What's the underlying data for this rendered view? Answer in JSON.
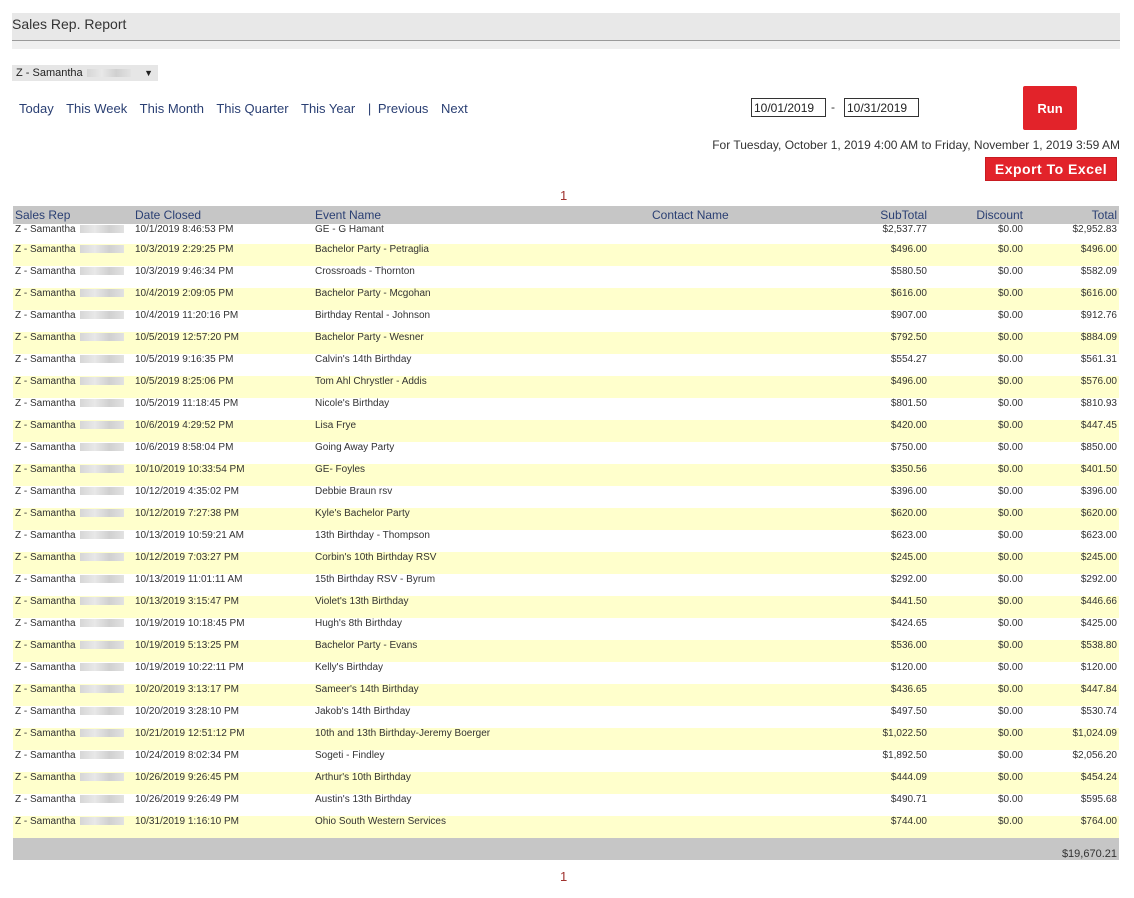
{
  "header": {
    "title": "Sales Rep. Report"
  },
  "rep_select": {
    "value": "Z - Samantha"
  },
  "periods": [
    "Today",
    "This Week",
    "This Month",
    "This Quarter",
    "This Year"
  ],
  "period_separator": "|",
  "nav": {
    "previous": "Previous",
    "next": "Next"
  },
  "date_range": {
    "start": "10/01/2019",
    "dash": "-",
    "end": "10/31/2019"
  },
  "run_label": "Run",
  "range_text": "For Tuesday, October 1, 2019 4:00 AM to Friday, November 1, 2019 3:59 AM",
  "export_label": "Export To Excel",
  "pagination": {
    "current": "1"
  },
  "table": {
    "columns": [
      "Sales Rep",
      "Date Closed",
      "Event Name",
      "Contact Name",
      "SubTotal",
      "Discount",
      "Total"
    ],
    "rows": [
      {
        "rep": "Z - Samantha",
        "date": "10/1/2019 8:46:53 PM",
        "event": "GE - G Hamant",
        "contact": "",
        "subtotal": "$2,537.77",
        "discount": "$0.00",
        "total": "$2,952.83"
      },
      {
        "rep": "Z - Samantha",
        "date": "10/3/2019 2:29:25 PM",
        "event": "Bachelor Party - Petraglia",
        "contact": "",
        "subtotal": "$496.00",
        "discount": "$0.00",
        "total": "$496.00"
      },
      {
        "rep": "Z - Samantha",
        "date": "10/3/2019 9:46:34 PM",
        "event": "Crossroads - Thornton",
        "contact": "",
        "subtotal": "$580.50",
        "discount": "$0.00",
        "total": "$582.09"
      },
      {
        "rep": "Z - Samantha",
        "date": "10/4/2019 2:09:05 PM",
        "event": "Bachelor Party - Mcgohan",
        "contact": "",
        "subtotal": "$616.00",
        "discount": "$0.00",
        "total": "$616.00"
      },
      {
        "rep": "Z - Samantha",
        "date": "10/4/2019 11:20:16 PM",
        "event": "Birthday Rental - Johnson",
        "contact": "",
        "subtotal": "$907.00",
        "discount": "$0.00",
        "total": "$912.76"
      },
      {
        "rep": "Z - Samantha",
        "date": "10/5/2019 12:57:20 PM",
        "event": "Bachelor Party - Wesner",
        "contact": "",
        "subtotal": "$792.50",
        "discount": "$0.00",
        "total": "$884.09"
      },
      {
        "rep": "Z - Samantha",
        "date": "10/5/2019 9:16:35 PM",
        "event": "Calvin's 14th Birthday",
        "contact": "",
        "subtotal": "$554.27",
        "discount": "$0.00",
        "total": "$561.31"
      },
      {
        "rep": "Z - Samantha",
        "date": "10/5/2019 8:25:06 PM",
        "event": "Tom Ahl Chrystler - Addis",
        "contact": "",
        "subtotal": "$496.00",
        "discount": "$0.00",
        "total": "$576.00"
      },
      {
        "rep": "Z - Samantha",
        "date": "10/5/2019 11:18:45 PM",
        "event": "Nicole's Birthday",
        "contact": "",
        "subtotal": "$801.50",
        "discount": "$0.00",
        "total": "$810.93"
      },
      {
        "rep": "Z - Samantha",
        "date": "10/6/2019 4:29:52 PM",
        "event": "Lisa Frye",
        "contact": "",
        "subtotal": "$420.00",
        "discount": "$0.00",
        "total": "$447.45"
      },
      {
        "rep": "Z - Samantha",
        "date": "10/6/2019 8:58:04 PM",
        "event": "Going Away Party",
        "contact": "",
        "subtotal": "$750.00",
        "discount": "$0.00",
        "total": "$850.00"
      },
      {
        "rep": "Z - Samantha",
        "date": "10/10/2019 10:33:54 PM",
        "event": "GE- Foyles",
        "contact": "",
        "subtotal": "$350.56",
        "discount": "$0.00",
        "total": "$401.50"
      },
      {
        "rep": "Z - Samantha",
        "date": "10/12/2019 4:35:02 PM",
        "event": "Debbie Braun rsv",
        "contact": "",
        "subtotal": "$396.00",
        "discount": "$0.00",
        "total": "$396.00"
      },
      {
        "rep": "Z - Samantha",
        "date": "10/12/2019 7:27:38 PM",
        "event": "Kyle's Bachelor Party",
        "contact": "",
        "subtotal": "$620.00",
        "discount": "$0.00",
        "total": "$620.00"
      },
      {
        "rep": "Z - Samantha",
        "date": "10/13/2019 10:59:21 AM",
        "event": "13th Birthday - Thompson",
        "contact": "",
        "subtotal": "$623.00",
        "discount": "$0.00",
        "total": "$623.00"
      },
      {
        "rep": "Z - Samantha",
        "date": "10/12/2019 7:03:27 PM",
        "event": "Corbin's 10th Birthday RSV",
        "contact": "",
        "subtotal": "$245.00",
        "discount": "$0.00",
        "total": "$245.00"
      },
      {
        "rep": "Z - Samantha",
        "date": "10/13/2019 11:01:11 AM",
        "event": "15th Birthday RSV - Byrum",
        "contact": "",
        "subtotal": "$292.00",
        "discount": "$0.00",
        "total": "$292.00"
      },
      {
        "rep": "Z - Samantha",
        "date": "10/13/2019 3:15:47 PM",
        "event": "Violet's 13th Birthday",
        "contact": "",
        "subtotal": "$441.50",
        "discount": "$0.00",
        "total": "$446.66"
      },
      {
        "rep": "Z - Samantha",
        "date": "10/19/2019 10:18:45 PM",
        "event": "Hugh's 8th Birthday",
        "contact": "",
        "subtotal": "$424.65",
        "discount": "$0.00",
        "total": "$425.00"
      },
      {
        "rep": "Z - Samantha",
        "date": "10/19/2019 5:13:25 PM",
        "event": "Bachelor Party - Evans",
        "contact": "",
        "subtotal": "$536.00",
        "discount": "$0.00",
        "total": "$538.80"
      },
      {
        "rep": "Z - Samantha",
        "date": "10/19/2019 10:22:11 PM",
        "event": "Kelly's Birthday",
        "contact": "",
        "subtotal": "$120.00",
        "discount": "$0.00",
        "total": "$120.00"
      },
      {
        "rep": "Z - Samantha",
        "date": "10/20/2019 3:13:17 PM",
        "event": "Sameer's 14th Birthday",
        "contact": "",
        "subtotal": "$436.65",
        "discount": "$0.00",
        "total": "$447.84"
      },
      {
        "rep": "Z - Samantha",
        "date": "10/20/2019 3:28:10 PM",
        "event": "Jakob's 14th Birthday",
        "contact": "",
        "subtotal": "$497.50",
        "discount": "$0.00",
        "total": "$530.74"
      },
      {
        "rep": "Z - Samantha",
        "date": "10/21/2019 12:51:12 PM",
        "event": "10th and 13th Birthday-Jeremy Boerger",
        "contact": "",
        "subtotal": "$1,022.50",
        "discount": "$0.00",
        "total": "$1,024.09"
      },
      {
        "rep": "Z - Samantha",
        "date": "10/24/2019 8:02:34 PM",
        "event": "Sogeti - Findley",
        "contact": "",
        "subtotal": "$1,892.50",
        "discount": "$0.00",
        "total": "$2,056.20"
      },
      {
        "rep": "Z - Samantha",
        "date": "10/26/2019 9:26:45 PM",
        "event": "Arthur's 10th Birthday",
        "contact": "",
        "subtotal": "$444.09",
        "discount": "$0.00",
        "total": "$454.24"
      },
      {
        "rep": "Z - Samantha",
        "date": "10/26/2019 9:26:49 PM",
        "event": "Austin's 13th Birthday",
        "contact": "",
        "subtotal": "$490.71",
        "discount": "$0.00",
        "total": "$595.68"
      },
      {
        "rep": "Z - Samantha",
        "date": "10/31/2019 1:16:10 PM",
        "event": "Ohio South Western Services",
        "contact": "",
        "subtotal": "$744.00",
        "discount": "$0.00",
        "total": "$764.00"
      }
    ],
    "grand_total": "$19,670.21"
  },
  "colors": {
    "accent": "#e2232a",
    "header_bg": "#c6c6c6",
    "row_alt": "#ffffcc",
    "link": "#2a3f73"
  }
}
